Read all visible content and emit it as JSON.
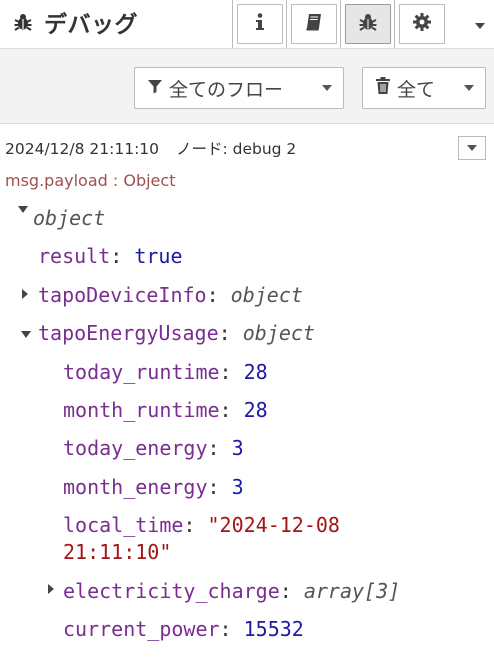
{
  "header": {
    "title": "デバッグ",
    "tabs": [
      {
        "name": "info",
        "icon": "info-icon"
      },
      {
        "name": "book",
        "icon": "book-icon"
      },
      {
        "name": "debug",
        "icon": "bug-icon",
        "active": true
      },
      {
        "name": "settings",
        "icon": "gear-icon"
      }
    ]
  },
  "toolbar": {
    "filter_label": "全てのフロー",
    "clear_label": "全て"
  },
  "message": {
    "timestamp": "2024/12/8 21:11:10",
    "node": "ノード: debug 2",
    "topic": "msg.payload : Object",
    "root_type": "object",
    "result_key": "result",
    "result_value": "true",
    "device_info_key": "tapoDeviceInfo",
    "device_info_type": "object",
    "energy_key": "tapoEnergyUsage",
    "energy_type": "object",
    "today_runtime_key": "today_runtime",
    "today_runtime_value": "28",
    "month_runtime_key": "month_runtime",
    "month_runtime_value": "28",
    "today_energy_key": "today_energy",
    "today_energy_value": "3",
    "month_energy_key": "month_energy",
    "month_energy_value": "3",
    "local_time_key": "local_time",
    "local_time_value_line1": "\"2024-12-08",
    "local_time_value_line2": "21:11:10\"",
    "electricity_charge_key": "electricity_charge",
    "electricity_charge_type": "array[3]",
    "current_power_key": "current_power",
    "current_power_value": "15532"
  },
  "colors": {
    "key": "#792e90",
    "number": "#1a1aa6",
    "string": "#a31515",
    "topic": "#a05050"
  }
}
